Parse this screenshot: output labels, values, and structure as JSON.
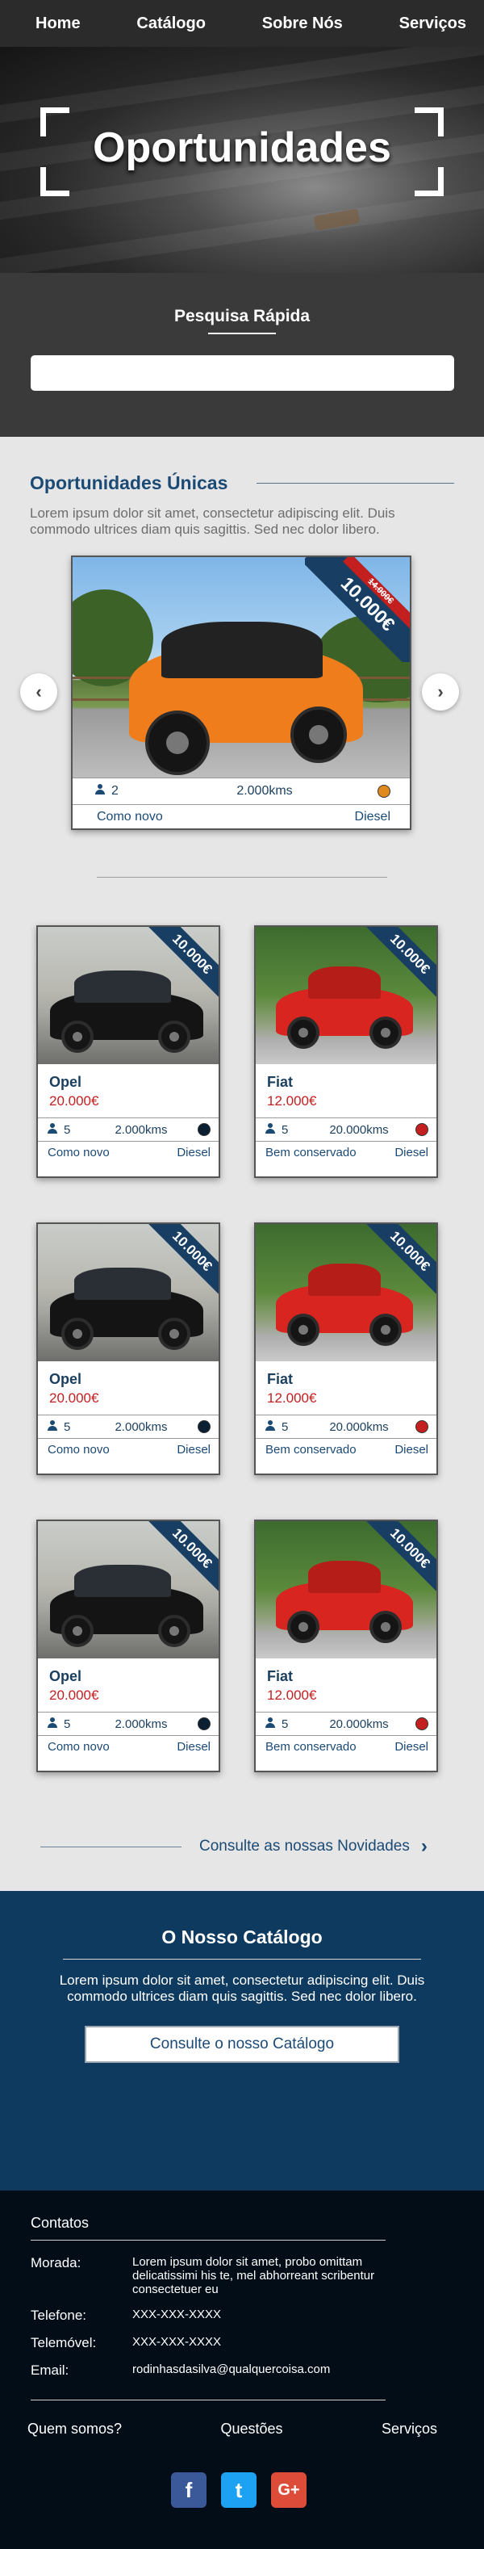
{
  "nav": {
    "items": [
      "Home",
      "Catálogo",
      "Sobre Nós",
      "Serviços"
    ]
  },
  "hero": {
    "title": "Oportunidades"
  },
  "quick_search": {
    "title": "Pesquisa Rápida",
    "placeholder": ""
  },
  "opportunities": {
    "title": "Oportunidades Únicas",
    "text": "Lorem ipsum dolor sit amet, consectetur adipiscing elit. Duis commodo ultrices diam quis sagittis. Sed nec dolor libero.",
    "featured": {
      "price": "10.000€",
      "old_price": "14.000€",
      "seats": "2",
      "kms": "2.000kms",
      "color": "#e08a1e",
      "condition": "Como novo",
      "fuel": "Diesel"
    }
  },
  "cars": [
    {
      "brand": "Opel",
      "price": "20.000€",
      "ribbon": "10.000€",
      "seats": "5",
      "kms": "2.000kms",
      "color": "#0b1f33",
      "condition": "Como novo",
      "fuel": "Diesel",
      "kind": "opel"
    },
    {
      "brand": "Fiat",
      "price": "12.000€",
      "ribbon": "10.000€",
      "seats": "5",
      "kms": "20.000kms",
      "color": "#c41f1f",
      "condition": "Bem conservado",
      "fuel": "Diesel",
      "kind": "fiat"
    },
    {
      "brand": "Opel",
      "price": "20.000€",
      "ribbon": "10.000€",
      "seats": "5",
      "kms": "2.000kms",
      "color": "#0b1f33",
      "condition": "Como novo",
      "fuel": "Diesel",
      "kind": "opel"
    },
    {
      "brand": "Fiat",
      "price": "12.000€",
      "ribbon": "10.000€",
      "seats": "5",
      "kms": "20.000kms",
      "color": "#c41f1f",
      "condition": "Bem conservado",
      "fuel": "Diesel",
      "kind": "fiat"
    },
    {
      "brand": "Opel",
      "price": "20.000€",
      "ribbon": "10.000€",
      "seats": "5",
      "kms": "2.000kms",
      "color": "#0b1f33",
      "condition": "Como novo",
      "fuel": "Diesel",
      "kind": "opel"
    },
    {
      "brand": "Fiat",
      "price": "12.000€",
      "ribbon": "10.000€",
      "seats": "5",
      "kms": "20.000kms",
      "color": "#c41f1f",
      "condition": "Bem conservado",
      "fuel": "Diesel",
      "kind": "fiat"
    }
  ],
  "novidades": {
    "link": "Consulte as nossas Novidades",
    "icon": "chevron-right-icon"
  },
  "catalog": {
    "title": "O Nosso Catálogo",
    "text": "Lorem ipsum dolor sit amet, consectetur adipiscing elit. Duis commodo ultrices diam quis sagittis. Sed nec dolor libero.",
    "button": "Consulte o nosso Catálogo"
  },
  "footer": {
    "contacts_title": "Contatos",
    "address_label": "Morada:",
    "address": "Lorem ipsum dolor sit amet, probo omittam delicatissimi his te, mel abhorreant scribentur consectetuer eu",
    "phone_label": "Telefone:",
    "phone": "XXX-XXX-XXXX",
    "mobile_label": "Telemóvel:",
    "mobile": "XXX-XXX-XXXX",
    "email_label": "Email:",
    "email": "rodinhasdasilva@qualquercoisa.com",
    "links": [
      "Quem somos?",
      "Questões",
      "Serviços"
    ],
    "social": [
      {
        "name": "facebook-icon",
        "glyph": "f"
      },
      {
        "name": "twitter-icon",
        "glyph": "t"
      },
      {
        "name": "google-plus-icon",
        "glyph": "G+"
      }
    ]
  },
  "colors": {
    "nav": "#2b2b2b",
    "accent": "#1b4a75",
    "price": "#c41f1f",
    "catalog_bg": "#0e3a60",
    "footer_bg": "#030d18"
  }
}
